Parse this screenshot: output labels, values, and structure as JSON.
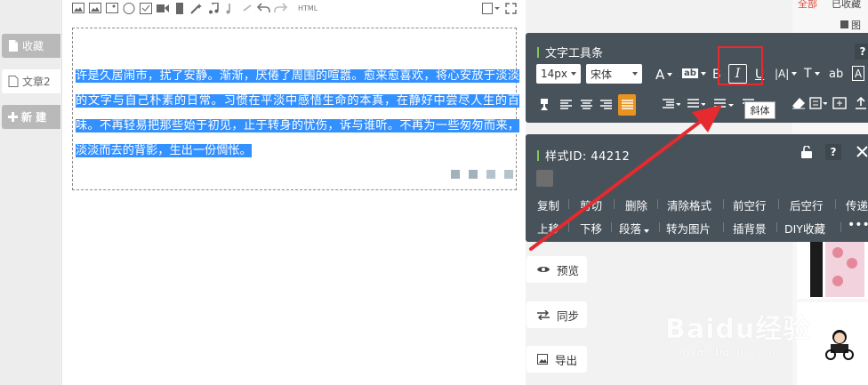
{
  "sidebar": {
    "items": [
      {
        "label": "收藏",
        "icon": "file-icon",
        "active": false
      },
      {
        "label": "文章2",
        "icon": "file-icon",
        "active": true
      },
      {
        "label": "新 建",
        "icon": "plus-icon",
        "active": false
      }
    ]
  },
  "editor": {
    "toolbar_html_label": "HTML",
    "selected_text": "许是久居闹市，扰了安静。渐渐，厌倦了周围的喧嚣。愈来愈喜欢，将心安放于淡淡的文字与自己朴素的日常。习惯在平淡中感悟生命的本真，在静好中尝尽人生的百味。不再轻易把那些始于初见，止于转身的忧伤，诉与谁听。不再为一些匆匆而来，淡淡而去的背影，生出一份惆怅。"
  },
  "text_panel": {
    "title": "文字工具条",
    "help": "?",
    "font_size": "14px",
    "font_family": "宋体",
    "italic_tooltip": "斜体",
    "glyphs": {
      "font_color": "A",
      "bg_color": "ab",
      "bold": "B",
      "italic": "I",
      "underline": "U",
      "spacing": "|A|",
      "text_t": "T",
      "strike": "ab",
      "box_a": "A"
    }
  },
  "style_panel": {
    "title": "样式ID: 44212",
    "help": "?",
    "row1": [
      "复制",
      "剪切",
      "删除",
      "清除格式",
      "前空行",
      "后空行",
      "传递"
    ],
    "row2": [
      "上移",
      "下移",
      "段落",
      "转为图片",
      "插背景",
      "DIY收藏",
      "•••"
    ]
  },
  "side_buttons": [
    {
      "label": "预览",
      "icon": "eye-icon"
    },
    {
      "label": "同步",
      "icon": "sync-icon"
    },
    {
      "label": "导出",
      "icon": "image-icon"
    }
  ],
  "right_col": {
    "top_labels": [
      "全部",
      "已收藏"
    ],
    "img_label": "图片"
  },
  "watermark": {
    "brand": "Baidu经验",
    "url": "jingyan.baidu.com"
  },
  "colors": {
    "panel_bg": "#47525a",
    "selection": "#3390ff",
    "highlight_red": "#e52a30",
    "active_align": "#e8941e",
    "accent_green": "#7ec65a"
  }
}
